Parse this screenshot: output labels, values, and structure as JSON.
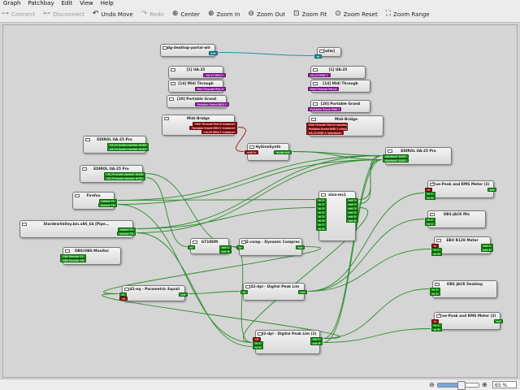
{
  "menu": [
    "Graph",
    "Patchbay",
    "Edit",
    "View",
    "Help"
  ],
  "toolbar": [
    {
      "id": "connect",
      "label": "Connect",
      "icon": "connect-icon",
      "glyph": "⊶",
      "enabled": false
    },
    {
      "id": "disconnect",
      "label": "Disconnect",
      "icon": "disconnect-icon",
      "glyph": "⊷",
      "enabled": false
    },
    {
      "id": "undo-move",
      "label": "Undo Move",
      "icon": "undo-icon",
      "glyph": "↶",
      "enabled": true
    },
    {
      "id": "redo",
      "label": "Redo",
      "icon": "redo-icon",
      "glyph": "↷",
      "enabled": false
    },
    {
      "id": "center",
      "label": "Center",
      "icon": "center-icon",
      "glyph": "⊕",
      "enabled": true
    },
    {
      "id": "zoom-in",
      "label": "Zoom In",
      "icon": "zoom-in-icon",
      "glyph": "⊕",
      "enabled": true
    },
    {
      "id": "zoom-out",
      "label": "Zoom Out",
      "icon": "zoom-out-icon",
      "glyph": "⊖",
      "enabled": true
    },
    {
      "id": "zoom-fit",
      "label": "Zoom Fit",
      "icon": "zoom-fit-icon",
      "glyph": "⊡",
      "enabled": true
    },
    {
      "id": "zoom-reset",
      "label": "Zoom Reset",
      "icon": "zoom-reset-icon",
      "glyph": "⊙",
      "enabled": true
    },
    {
      "id": "zoom-range",
      "label": "Zoom Range",
      "icon": "zoom-range-icon",
      "glyph": "⛶",
      "enabled": true
    }
  ],
  "colors": {
    "audio": "#1e9e1e",
    "midi": "#9e1414",
    "alsa_midi": "#9b1fa8",
    "video": "#1b95a6",
    "wire_audio": "#2e8b2e",
    "wire_midi": "#a01818",
    "wire_video": "#1b95a6"
  },
  "nodes": [
    {
      "id": "xdg-portal",
      "title": "xdg-desktop-portal-wlr",
      "ports": [
        {
          "dir": "out",
          "type": "c",
          "label": "out"
        }
      ]
    },
    {
      "id": "wlm",
      "title": "[wlm]",
      "ports": [
        {
          "dir": "in",
          "type": "c",
          "label": "in"
        }
      ]
    },
    {
      "id": "ua25-a",
      "title": "[1] UA-25",
      "ports": [
        {
          "dir": "out",
          "type": "p",
          "label": "UA-25 MIDI 1"
        }
      ]
    },
    {
      "id": "midi-through-a",
      "title": "[14] Midi Through",
      "ports": [
        {
          "dir": "out",
          "type": "p",
          "label": "Midi Through Port-0"
        }
      ]
    },
    {
      "id": "portable-grand-a",
      "title": "[20] Portable Grand",
      "ports": [
        {
          "dir": "out",
          "type": "p",
          "label": "Portable Grand MIDI 1"
        }
      ]
    },
    {
      "id": "ua25-b",
      "title": "[1] UA-25",
      "ports": [
        {
          "dir": "in",
          "type": "p",
          "label": "UA-25 MIDI 1"
        }
      ]
    },
    {
      "id": "midi-through-b",
      "title": "[14] Midi Through",
      "ports": [
        {
          "dir": "in",
          "type": "p",
          "label": "Midi Through Port-0"
        }
      ]
    },
    {
      "id": "portable-grand-b",
      "title": "[20] Portable Grand",
      "ports": [
        {
          "dir": "in",
          "type": "p",
          "label": "Portable Grand MIDI 1"
        }
      ]
    },
    {
      "id": "midi-bridge-a",
      "title": "Midi-Bridge",
      "ports": [
        {
          "dir": "out",
          "type": "r",
          "label": "Midi Through Port-0 (capture)"
        },
        {
          "dir": "out",
          "type": "r",
          "label": "Portable Grand MIDI 1 (capture)"
        },
        {
          "dir": "out",
          "type": "r",
          "label": "UA-25 MIDI 1 (capture)"
        }
      ]
    },
    {
      "id": "midi-bridge-b",
      "title": "Midi-Bridge",
      "ports": [
        {
          "dir": "in",
          "type": "r",
          "label": "Midi Through Port-0 (playback)"
        },
        {
          "dir": "in",
          "type": "r",
          "label": "Portable Grand MIDI 1 (playback)"
        },
        {
          "dir": "in",
          "type": "r",
          "label": "UA-25 MIDI 1 (playback)"
        }
      ]
    },
    {
      "id": "edirol-a",
      "title": "EDIROL UA-25 Pro",
      "ports": [
        {
          "dir": "out",
          "type": "g",
          "label": "UA-25 Audio monitor_AUX0"
        },
        {
          "dir": "out",
          "type": "g",
          "label": "UA-25 Audio monitor_AUX1"
        }
      ]
    },
    {
      "id": "qsynth",
      "title": "HySineSynth",
      "ports": [
        {
          "dir": "in",
          "type": "r",
          "label": "midi in"
        },
        {
          "dir": "out",
          "type": "g",
          "label": "audio out"
        }
      ]
    },
    {
      "id": "edirol-sink",
      "title": "EDIROL UA-25 Pro",
      "ports": [
        {
          "dir": "in",
          "type": "g",
          "label": "playback_AUX0"
        },
        {
          "dir": "in",
          "type": "g",
          "label": "playback_AUX1"
        }
      ]
    },
    {
      "id": "edirol-src",
      "title": "EDIROL UA-25 Pro",
      "ports": [
        {
          "dir": "out",
          "type": "g",
          "label": "UA-25 Audio capture_AUX0"
        },
        {
          "dir": "out",
          "type": "g",
          "label": "UA-25 Audio capture_AUX1"
        }
      ]
    },
    {
      "id": "firefox",
      "title": "Firefox",
      "ports": [
        {
          "dir": "out",
          "type": "g",
          "label": "output_FL"
        },
        {
          "dir": "out",
          "type": "g",
          "label": "output_FR"
        }
      ]
    },
    {
      "id": "stardew",
      "title": "StardewValley.bin.x86_64 [Pipe...",
      "ports": [
        {
          "dir": "out",
          "type": "g",
          "label": "output_FL"
        },
        {
          "dir": "out",
          "type": "g",
          "label": "output_FR"
        }
      ]
    },
    {
      "id": "obs-monitor",
      "title": "OBS/OBS-Monitor",
      "ports": [
        {
          "dir": "in",
          "type": "g",
          "label": "OBS Monitor_FL"
        },
        {
          "dir": "in",
          "type": "g",
          "label": "OBS Monitor_FR"
        }
      ]
    },
    {
      "id": "alsa-ms1",
      "title": "alsa-ms1",
      "ports": [
        {
          "dir": "in",
          "type": "g",
          "label": "in_1"
        },
        {
          "dir": "in",
          "type": "g",
          "label": "in_2"
        },
        {
          "dir": "in",
          "type": "g",
          "label": "in_3"
        },
        {
          "dir": "in",
          "type": "g",
          "label": "in_4"
        },
        {
          "dir": "in",
          "type": "g",
          "label": "in_5"
        },
        {
          "dir": "in",
          "type": "g",
          "label": "in_6"
        },
        {
          "dir": "in",
          "type": "g",
          "label": "in_7"
        },
        {
          "dir": "in",
          "type": "g",
          "label": "in_8"
        },
        {
          "dir": "out",
          "type": "g",
          "label": "out_1"
        },
        {
          "dir": "out",
          "type": "g",
          "label": "out_2"
        },
        {
          "dir": "out",
          "type": "g",
          "label": "out_3"
        },
        {
          "dir": "out",
          "type": "g",
          "label": "out_4"
        },
        {
          "dir": "out",
          "type": "g",
          "label": "out_5"
        },
        {
          "dir": "out",
          "type": "g",
          "label": "out_6"
        }
      ]
    },
    {
      "id": "peak-a",
      "title": "True-Peak and RMS Meter (2)",
      "ports": [
        {
          "dir": "in",
          "type": "r",
          "label": "in"
        },
        {
          "dir": "in",
          "type": "g",
          "label": "in_L"
        },
        {
          "dir": "in",
          "type": "g",
          "label": "in_R"
        },
        {
          "dir": "out",
          "type": "g",
          "label": "out"
        }
      ]
    },
    {
      "id": "obs-jack-mic",
      "title": "OBS JACK Mic",
      "ports": [
        {
          "dir": "in",
          "type": "g",
          "label": "in_1"
        },
        {
          "dir": "in",
          "type": "g",
          "label": "in_2"
        }
      ]
    },
    {
      "id": "ebu",
      "title": "EBU R128 Meter",
      "ports": [
        {
          "dir": "in",
          "type": "r",
          "label": "in"
        },
        {
          "dir": "in",
          "type": "g",
          "label": "in_L"
        },
        {
          "dir": "in",
          "type": "g",
          "label": "in_R"
        },
        {
          "dir": "out",
          "type": "g",
          "label": "out_L"
        },
        {
          "dir": "out",
          "type": "g",
          "label": "out_R"
        }
      ]
    },
    {
      "id": "gt10dm",
      "title": "GT10DM",
      "ports": [
        {
          "dir": "in",
          "type": "g",
          "label": "in"
        },
        {
          "dir": "out",
          "type": "g",
          "label": "out_L"
        },
        {
          "dir": "out",
          "type": "g",
          "label": "out_R"
        }
      ]
    },
    {
      "id": "x42-comp",
      "title": "x42-comp - Dynamic Compres",
      "ports": [
        {
          "dir": "in",
          "type": "g",
          "label": "in"
        },
        {
          "dir": "out",
          "type": "g",
          "label": "out"
        }
      ]
    },
    {
      "id": "x42-eq",
      "title": "x42-eq - Parametric Equali",
      "ports": [
        {
          "dir": "in",
          "type": "g",
          "label": "in"
        },
        {
          "dir": "in",
          "type": "r",
          "label": "ctl"
        },
        {
          "dir": "out",
          "type": "g",
          "label": "out"
        }
      ]
    },
    {
      "id": "x42-dpl",
      "title": "x42-dpl - Digital Peak Lim",
      "ports": [
        {
          "dir": "in",
          "type": "g",
          "label": "in"
        },
        {
          "dir": "out",
          "type": "g",
          "label": "out"
        }
      ]
    },
    {
      "id": "obs-jack-desktop",
      "title": "OBS JACK Desktop",
      "ports": [
        {
          "dir": "in",
          "type": "g",
          "label": "in_1"
        },
        {
          "dir": "in",
          "type": "g",
          "label": "in_2"
        }
      ]
    },
    {
      "id": "peak-b",
      "title": "True-Peak and RMS Meter (3)",
      "ports": [
        {
          "dir": "in",
          "type": "r",
          "label": "in"
        },
        {
          "dir": "in",
          "type": "g",
          "label": "in_L"
        },
        {
          "dir": "in",
          "type": "g",
          "label": "in_R"
        },
        {
          "dir": "out",
          "type": "g",
          "label": "out"
        }
      ]
    },
    {
      "id": "x42-dpl2",
      "title": "x42-dpl - Digital Peak Lim (2)",
      "ports": [
        {
          "dir": "in",
          "type": "r",
          "label": "ctl"
        },
        {
          "dir": "in",
          "type": "g",
          "label": "in_L"
        },
        {
          "dir": "in",
          "type": "g",
          "label": "in_R"
        },
        {
          "dir": "out",
          "type": "g",
          "label": "out_L"
        },
        {
          "dir": "out",
          "type": "g",
          "label": "out_R"
        }
      ]
    }
  ],
  "status": {
    "zoom_value": "65 %",
    "zoom_fraction": 0.55,
    "zoom_out_icon": "zoom-out-icon",
    "zoom_in_icon": "zoom-in-icon"
  }
}
